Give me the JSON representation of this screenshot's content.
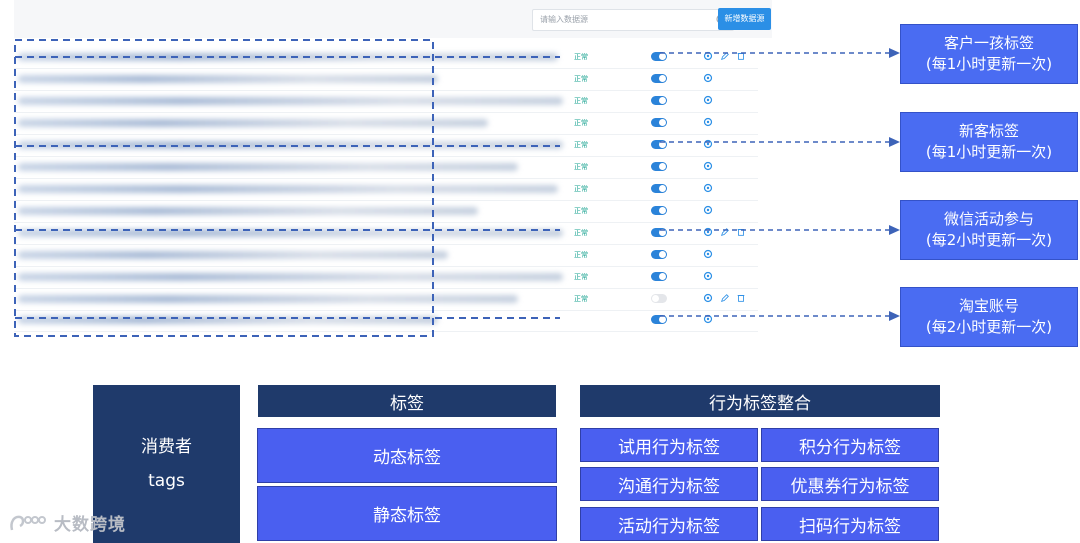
{
  "screenshot": {
    "search_placeholder": "请输入数据源",
    "new_button_label": "新增数据源",
    "rows": [
      {
        "status": "正常",
        "toggle": "on",
        "actions": [
          "gear",
          "edit",
          "delete"
        ]
      },
      {
        "status": "正常",
        "toggle": "on",
        "actions": [
          "gear"
        ]
      },
      {
        "status": "正常",
        "toggle": "on",
        "actions": [
          "gear"
        ]
      },
      {
        "status": "正常",
        "toggle": "on",
        "actions": [
          "gear"
        ]
      },
      {
        "status": "正常",
        "toggle": "on",
        "actions": [
          "gear"
        ]
      },
      {
        "status": "正常",
        "toggle": "on",
        "actions": [
          "gear"
        ]
      },
      {
        "status": "正常",
        "toggle": "on",
        "actions": [
          "gear"
        ]
      },
      {
        "status": "正常",
        "toggle": "on",
        "actions": [
          "gear"
        ]
      },
      {
        "status": "正常",
        "toggle": "on",
        "actions": [
          "gear",
          "edit",
          "delete"
        ]
      },
      {
        "status": "正常",
        "toggle": "on",
        "actions": [
          "gear"
        ]
      },
      {
        "status": "正常",
        "toggle": "on",
        "actions": [
          "gear"
        ]
      },
      {
        "status": "正常",
        "toggle": "off",
        "actions": [
          "gear",
          "edit",
          "delete"
        ]
      },
      {
        "status": "",
        "toggle": "on",
        "actions": [
          "gear"
        ]
      }
    ]
  },
  "callouts": [
    {
      "title": "客户一孩标签",
      "note": "(每1小时更新一次)"
    },
    {
      "title": "新客标签",
      "note": "(每1小时更新一次)"
    },
    {
      "title": "微信活动参与",
      "note": "(每2小时更新一次)"
    },
    {
      "title": "淘宝账号",
      "note": "(每2小时更新一次)"
    }
  ],
  "diagram": {
    "consumer_line1": "消费者",
    "consumer_line2": "tags",
    "tag_header": "标签",
    "tag_items": [
      "动态标签",
      "静态标签"
    ],
    "behavior_header": "行为标签整合",
    "behavior_items": [
      "试用行为标签",
      "积分行为标签",
      "沟通行为标签",
      "优惠券行为标签",
      "活动行为标签",
      "扫码行为标签"
    ]
  },
  "watermark": "大数跨境",
  "colors": {
    "accent": "#4a5ff0",
    "navy": "#1f3a6b",
    "status_green": "#1aa391",
    "toggle_blue": "#2b83d9"
  }
}
